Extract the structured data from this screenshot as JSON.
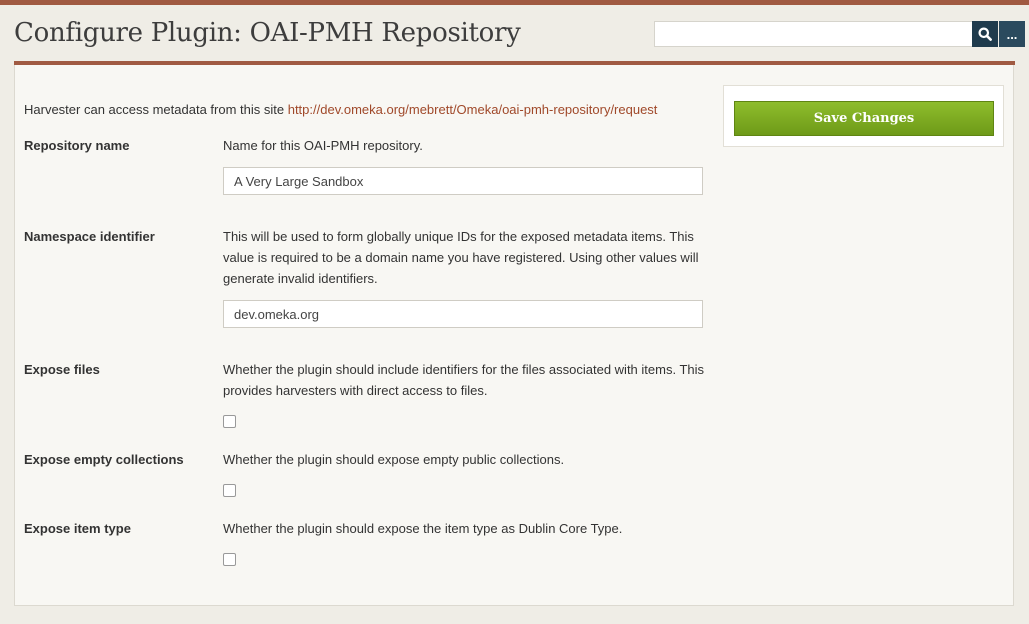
{
  "header": {
    "title": "Configure Plugin: OAI-PMH Repository",
    "search_value": "",
    "search_icon": "search-icon",
    "advanced_label": "..."
  },
  "form": {
    "intro_text": "Harvester can access metadata from this site ",
    "intro_link": "http://dev.omeka.org/mebrett/Omeka/oai-pmh-repository/request",
    "fields": [
      {
        "label": "Repository name",
        "description": "Name for this OAI-PMH repository.",
        "value": "A Very Large Sandbox"
      },
      {
        "label": "Namespace identifier",
        "description": "This will be used to form globally unique IDs for the exposed metadata items. This value is required to be a domain name you have registered. Using other values will generate invalid identifiers.",
        "value": "dev.omeka.org"
      },
      {
        "label": "Expose files",
        "description": "Whether the plugin should include identifiers for the files associated with items. This provides harvesters with direct access to files.",
        "checked": false
      },
      {
        "label": "Expose empty collections",
        "description": "Whether the plugin should expose empty public collections.",
        "checked": false
      },
      {
        "label": "Expose item type",
        "description": "Whether the plugin should expose the item type as Dublin Core Type.",
        "checked": false
      }
    ]
  },
  "sidebar": {
    "save_label": "Save Changes"
  },
  "colors": {
    "accent": "#a05a42",
    "save_button": "#7aa821",
    "search_button": "#1f3b4d",
    "link": "#a0492a"
  }
}
